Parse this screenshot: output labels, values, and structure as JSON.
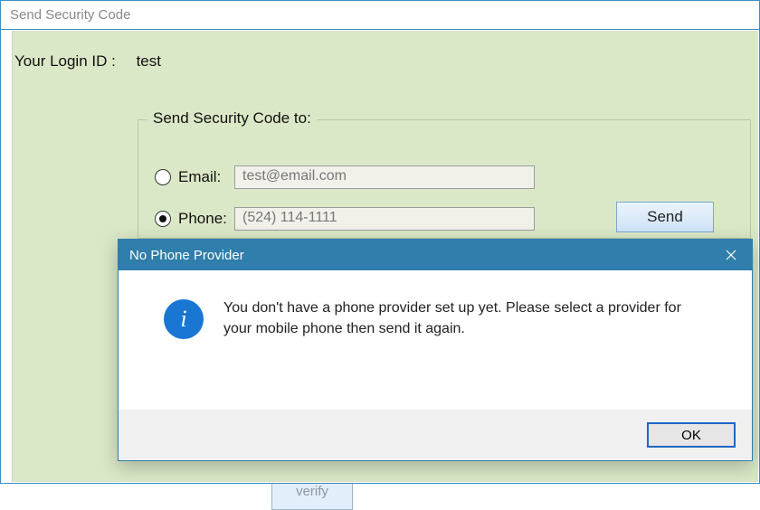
{
  "window": {
    "title": "Send Security Code"
  },
  "login": {
    "label": "Your Login ID :",
    "value": "test"
  },
  "fieldset": {
    "legend": "Send Security Code to:",
    "email": {
      "radio_label": "Email:",
      "selected": false,
      "value": "test@email.com"
    },
    "phone": {
      "radio_label": "Phone:",
      "selected": true,
      "value": "(524) 114-1111"
    },
    "send_label": "Send"
  },
  "verify_stub_label": "verify",
  "dialog": {
    "title": "No Phone Provider",
    "message": "You don't have a phone provider set up yet. Please select a provider for your mobile phone then send it again.",
    "ok_label": "OK"
  }
}
